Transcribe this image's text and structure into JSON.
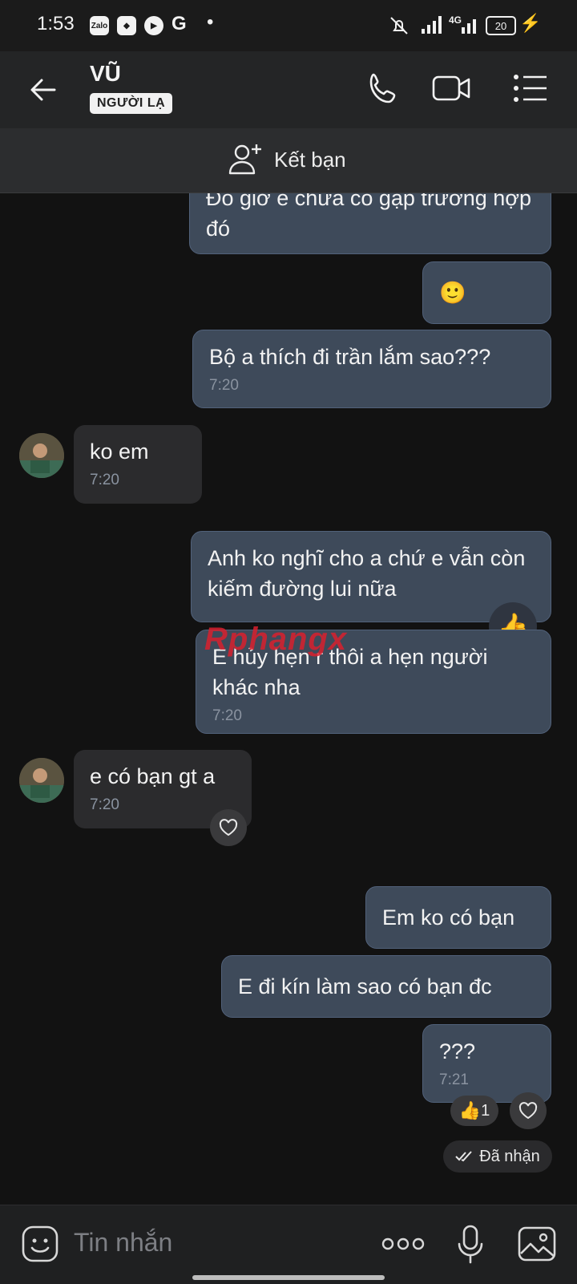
{
  "status_bar": {
    "time": "1:53",
    "app_icons": [
      "zalo-icon",
      "game-icon",
      "youtube-icon",
      "google-icon"
    ],
    "network": "4G",
    "battery": "20"
  },
  "header": {
    "contact_name": "VŨ",
    "badge": "NGƯỜI LẠ",
    "icons": [
      "back-arrow-icon",
      "phone-icon",
      "video-call-icon",
      "menu-list-icon"
    ]
  },
  "friend_bar": {
    "label": "Kết bạn"
  },
  "messages": [
    {
      "dir": "out",
      "text": "Đó giờ e chưa có gặp trường hợp đó"
    },
    {
      "dir": "out",
      "text": "🙂"
    },
    {
      "dir": "out",
      "text": "Bộ a thích đi trần lắm sao???",
      "time": "7:20"
    },
    {
      "dir": "in",
      "text": "ko em",
      "time": "7:20"
    },
    {
      "dir": "out",
      "text": "Anh ko nghĩ cho a chứ e vẫn còn kiếm đường lui nữa",
      "reaction": "👍"
    },
    {
      "dir": "out",
      "text": "E hủy hẹn r thôi a hẹn người khác nha",
      "time": "7:20"
    },
    {
      "dir": "in",
      "text": "e có bạn gt a",
      "time": "7:20"
    },
    {
      "dir": "out",
      "text": "Em ko có bạn"
    },
    {
      "dir": "out",
      "text": "E đi kín làm sao có bạn đc"
    },
    {
      "dir": "out",
      "text": "???",
      "time": "7:21",
      "reaction": "👍",
      "reaction_count": "1"
    }
  ],
  "watermark": "Rphangx",
  "delivery_status": "Đã nhận",
  "composer": {
    "placeholder": "Tin nhắn"
  },
  "colors": {
    "background": "#121212",
    "outgoing_bubble": "#3e4a5a",
    "incoming_bubble": "#2b2b2d",
    "header": "#242526"
  }
}
